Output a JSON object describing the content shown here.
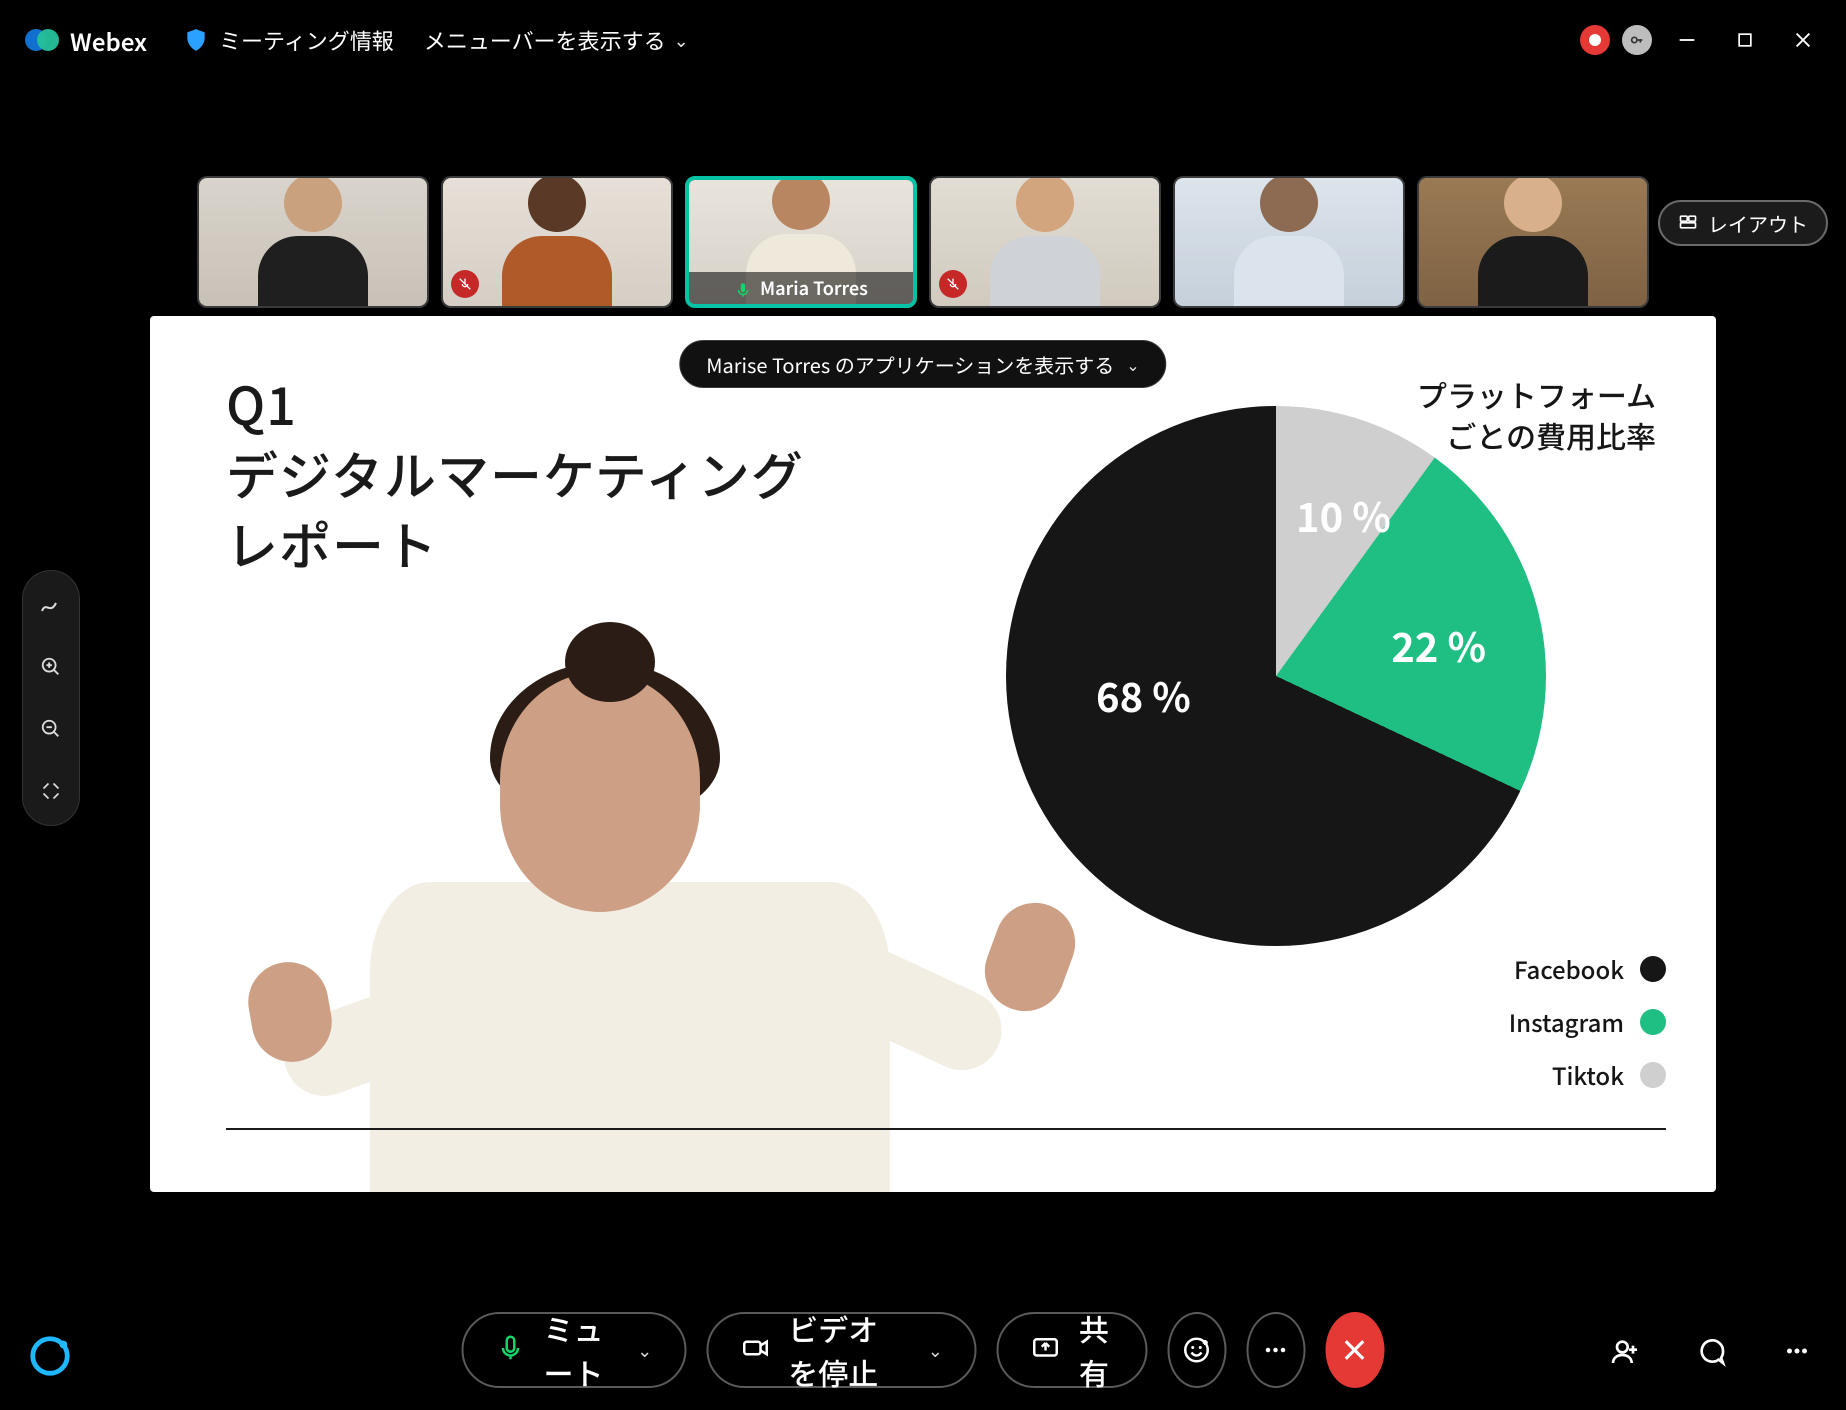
{
  "topbar": {
    "app_name": "Webex",
    "meeting_info": "ミーティング情報",
    "show_menubar": "メニューバーを表示する"
  },
  "layout_button": "レイアウト",
  "share_chip": "Marise Torres のアプリケーションを表示する",
  "participants": [
    {
      "name": ""
    },
    {
      "name": ""
    },
    {
      "name": "Maria Torres"
    },
    {
      "name": ""
    },
    {
      "name": ""
    },
    {
      "name": ""
    }
  ],
  "slide": {
    "title": "Q1\nデジタルマーケティング\nレポート",
    "subtitle": "プラットフォーム\nごとの費用比率"
  },
  "chart_data": {
    "type": "pie",
    "title": "プラットフォームごとの費用比率",
    "series": [
      {
        "name": "Facebook",
        "value": 68,
        "color": "#161616",
        "label": "68 %"
      },
      {
        "name": "Instagram",
        "value": 22,
        "color": "#1fbf83",
        "label": "22 %"
      },
      {
        "name": "Tiktok",
        "value": 10,
        "color": "#cfcfcf",
        "label": "10 %"
      }
    ],
    "legend": [
      "Facebook",
      "Instagram",
      "Tiktok"
    ]
  },
  "controls": {
    "mute": "ミュート",
    "stop_video": "ビデオを停止",
    "share": "共有"
  }
}
